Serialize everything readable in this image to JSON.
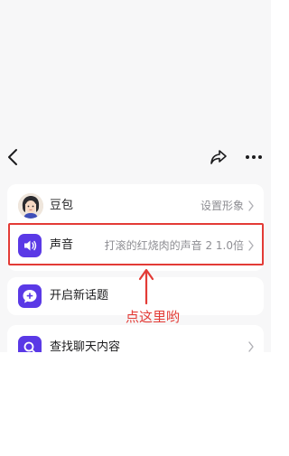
{
  "nav": {
    "back_icon": "chevron-left-icon",
    "share_icon": "share-icon",
    "more_icon": "more-dots-icon"
  },
  "settings": {
    "profile": {
      "label": "豆包",
      "value": "设置形象",
      "icon": "avatar"
    },
    "voice": {
      "label": "声音",
      "value": "打滚的红烧肉的声音 2 1.0倍",
      "icon": "speaker-icon"
    },
    "new_topic": {
      "label": "开启新话题",
      "icon": "chat-plus-icon"
    },
    "search_chat": {
      "label": "查找聊天内容",
      "icon": "search-icon"
    }
  },
  "annotation": {
    "text": "点这里哟",
    "color": "#e33b36"
  },
  "colors": {
    "accent": "#5a39e6",
    "highlight": "#e33b36"
  }
}
